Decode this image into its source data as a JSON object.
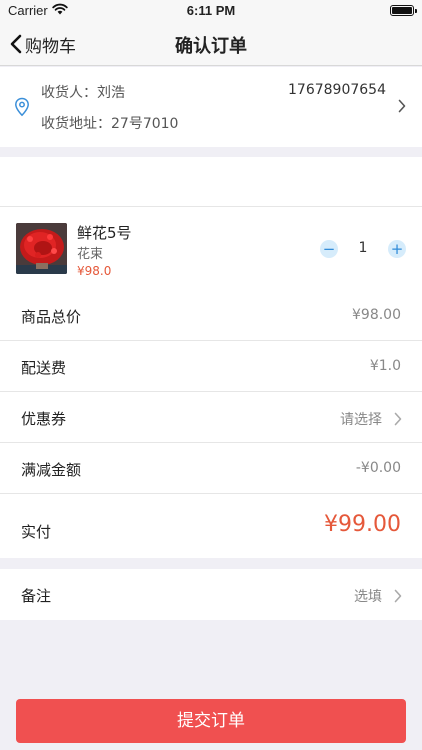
{
  "status_bar": {
    "carrier": "Carrier",
    "time": "6:11 PM"
  },
  "nav": {
    "back_label": "购物车",
    "title": "确认订单"
  },
  "address": {
    "recipient_label": "收货人：",
    "recipient_name": "刘浩",
    "phone": "17678907654",
    "address_label": "收货地址：",
    "address_value": "27号7010",
    "icon_color": "#3b8fd9"
  },
  "product": {
    "name": "鲜花5号",
    "category": "花束",
    "price": "¥98.0",
    "quantity": "1",
    "minus_symbol": "−",
    "plus_symbol": "+"
  },
  "summary": {
    "goods_total_label": "商品总价",
    "goods_total_value": "¥98.00",
    "delivery_label": "配送费",
    "delivery_value": "¥1.0",
    "coupon_label": "优惠券",
    "coupon_value": "请选择",
    "discount_label": "满减金额",
    "discount_value": "-¥0.00",
    "paid_label": "实付",
    "paid_value": "¥99.00"
  },
  "note": {
    "label": "备注",
    "value": "选填"
  },
  "submit_label": "提交订单",
  "colors": {
    "accent_price": "#e5583a",
    "submit_bg": "#f05050",
    "stepper_bg": "#d6ecfb",
    "stepper_fg": "#2e8ad8"
  }
}
